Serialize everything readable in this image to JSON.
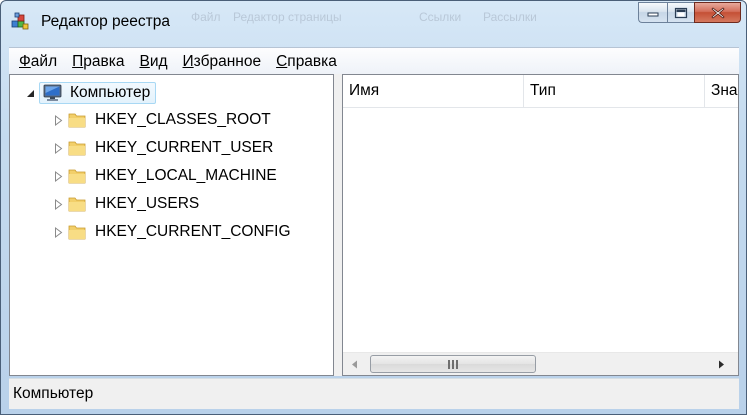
{
  "window": {
    "title": "Редактор реестра",
    "ghost_menu": [
      "Файл",
      "Редактор страницы",
      "Ссылки",
      "Рассылки"
    ]
  },
  "menu": [
    {
      "accel": "Ф",
      "rest": "айл"
    },
    {
      "accel": "П",
      "rest": "равка"
    },
    {
      "accel": "В",
      "rest": "ид"
    },
    {
      "accel": "И",
      "rest": "збранное"
    },
    {
      "accel": "С",
      "rest": "правка"
    }
  ],
  "tree": {
    "root": "Компьютер",
    "hives": [
      "HKEY_CLASSES_ROOT",
      "HKEY_CURRENT_USER",
      "HKEY_LOCAL_MACHINE",
      "HKEY_USERS",
      "HKEY_CURRENT_CONFIG"
    ]
  },
  "list": {
    "columns": [
      "Имя",
      "Тип",
      "Зна"
    ]
  },
  "status": {
    "path": "Компьютер"
  },
  "colors": {
    "frame": "#b9d1ea",
    "close_button": "#c44f35",
    "selection_border": "#a8d8f4",
    "folder": "#f2cf6a"
  },
  "icons": [
    "registry-editor-app-icon",
    "computer-icon",
    "folder-icon",
    "minimize-icon",
    "maximize-icon",
    "close-icon",
    "expand-arrow-icon",
    "collapse-arrow-icon",
    "scroll-left-icon",
    "scroll-right-icon",
    "scroll-grip-icon"
  ]
}
